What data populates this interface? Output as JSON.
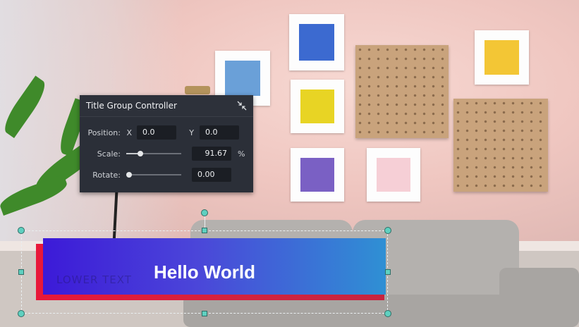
{
  "panel": {
    "title": "Title Group Controller",
    "position": {
      "label": "Position:",
      "x_label": "X",
      "x_value": "0.0",
      "y_label": "Y",
      "y_value": "0.0"
    },
    "scale": {
      "label": "Scale:",
      "value": "91.67",
      "unit": "%",
      "slider_fraction": 0.25
    },
    "rotate": {
      "label": "Rotate:",
      "value": "0.00",
      "slider_fraction": 0.0
    }
  },
  "title_overlay": {
    "text": "Hello World",
    "ghost_text": "LOWER TEXT",
    "colors": {
      "primary_bar": "#4b46d9",
      "secondary_bar": "#d2233f",
      "handle": "#5fd0c0"
    }
  },
  "icons": {
    "collapse": "collapse-arrows-icon"
  }
}
